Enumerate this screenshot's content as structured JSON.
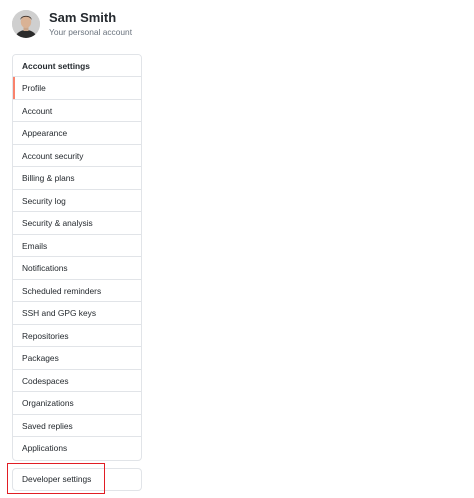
{
  "user": {
    "name": "Sam Smith",
    "subtitle": "Your personal account",
    "avatar_icon": "user-avatar"
  },
  "settings_menu": {
    "heading": "Account settings",
    "selected": "Profile",
    "accent_color": "#f9826c",
    "items": [
      {
        "label": "Profile"
      },
      {
        "label": "Account"
      },
      {
        "label": "Appearance"
      },
      {
        "label": "Account security"
      },
      {
        "label": "Billing & plans"
      },
      {
        "label": "Security log"
      },
      {
        "label": "Security & analysis"
      },
      {
        "label": "Emails"
      },
      {
        "label": "Notifications"
      },
      {
        "label": "Scheduled reminders"
      },
      {
        "label": "SSH and GPG keys"
      },
      {
        "label": "Repositories"
      },
      {
        "label": "Packages"
      },
      {
        "label": "Codespaces"
      },
      {
        "label": "Organizations"
      },
      {
        "label": "Saved replies"
      },
      {
        "label": "Applications"
      }
    ]
  },
  "developer_menu": {
    "label": "Developer settings",
    "highlight_color": "#e11d24"
  }
}
